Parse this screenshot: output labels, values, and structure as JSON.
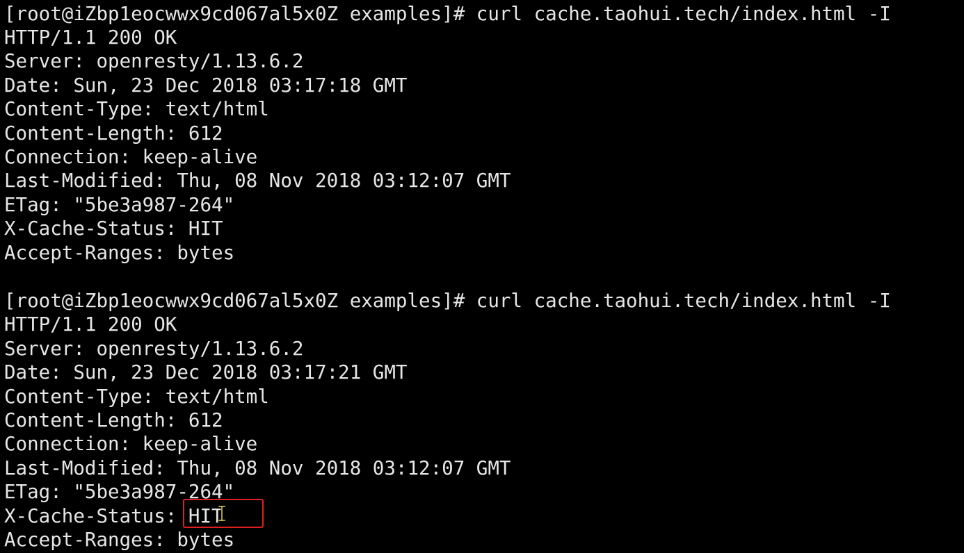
{
  "terminal": {
    "blocks": [
      {
        "prompt": "[root@iZbp1eocwwx9cd067al5x0Z examples]# curl cache.taohui.tech/index.html -I",
        "status_line": "HTTP/1.1 200 OK",
        "server": "Server: openresty/1.13.6.2",
        "date": "Date: Sun, 23 Dec 2018 03:17:18 GMT",
        "content_type": "Content-Type: text/html",
        "content_length": "Content-Length: 612",
        "connection": "Connection: keep-alive",
        "last_modified": "Last-Modified: Thu, 08 Nov 2018 03:12:07 GMT",
        "etag": "ETag: \"5be3a987-264\"",
        "x_cache_status": "X-Cache-Status: HIT",
        "accept_ranges": "Accept-Ranges: bytes"
      },
      {
        "prompt": "[root@iZbp1eocwwx9cd067al5x0Z examples]# curl cache.taohui.tech/index.html -I",
        "status_line": "HTTP/1.1 200 OK",
        "server": "Server: openresty/1.13.6.2",
        "date": "Date: Sun, 23 Dec 2018 03:17:21 GMT",
        "content_type": "Content-Type: text/html",
        "content_length": "Content-Length: 612",
        "connection": "Connection: keep-alive",
        "last_modified": "Last-Modified: Thu, 08 Nov 2018 03:12:07 GMT",
        "etag": "ETag: \"5be3a987-264\"",
        "x_cache_status": "X-Cache-Status: HIT",
        "accept_ranges": "Accept-Ranges: bytes"
      }
    ],
    "colors": {
      "background": "#000000",
      "text": "#e6e6e6",
      "highlight_border": "#e02020",
      "cursor": "#d8c24a"
    },
    "cursor_icon": "text-cursor-icon"
  }
}
